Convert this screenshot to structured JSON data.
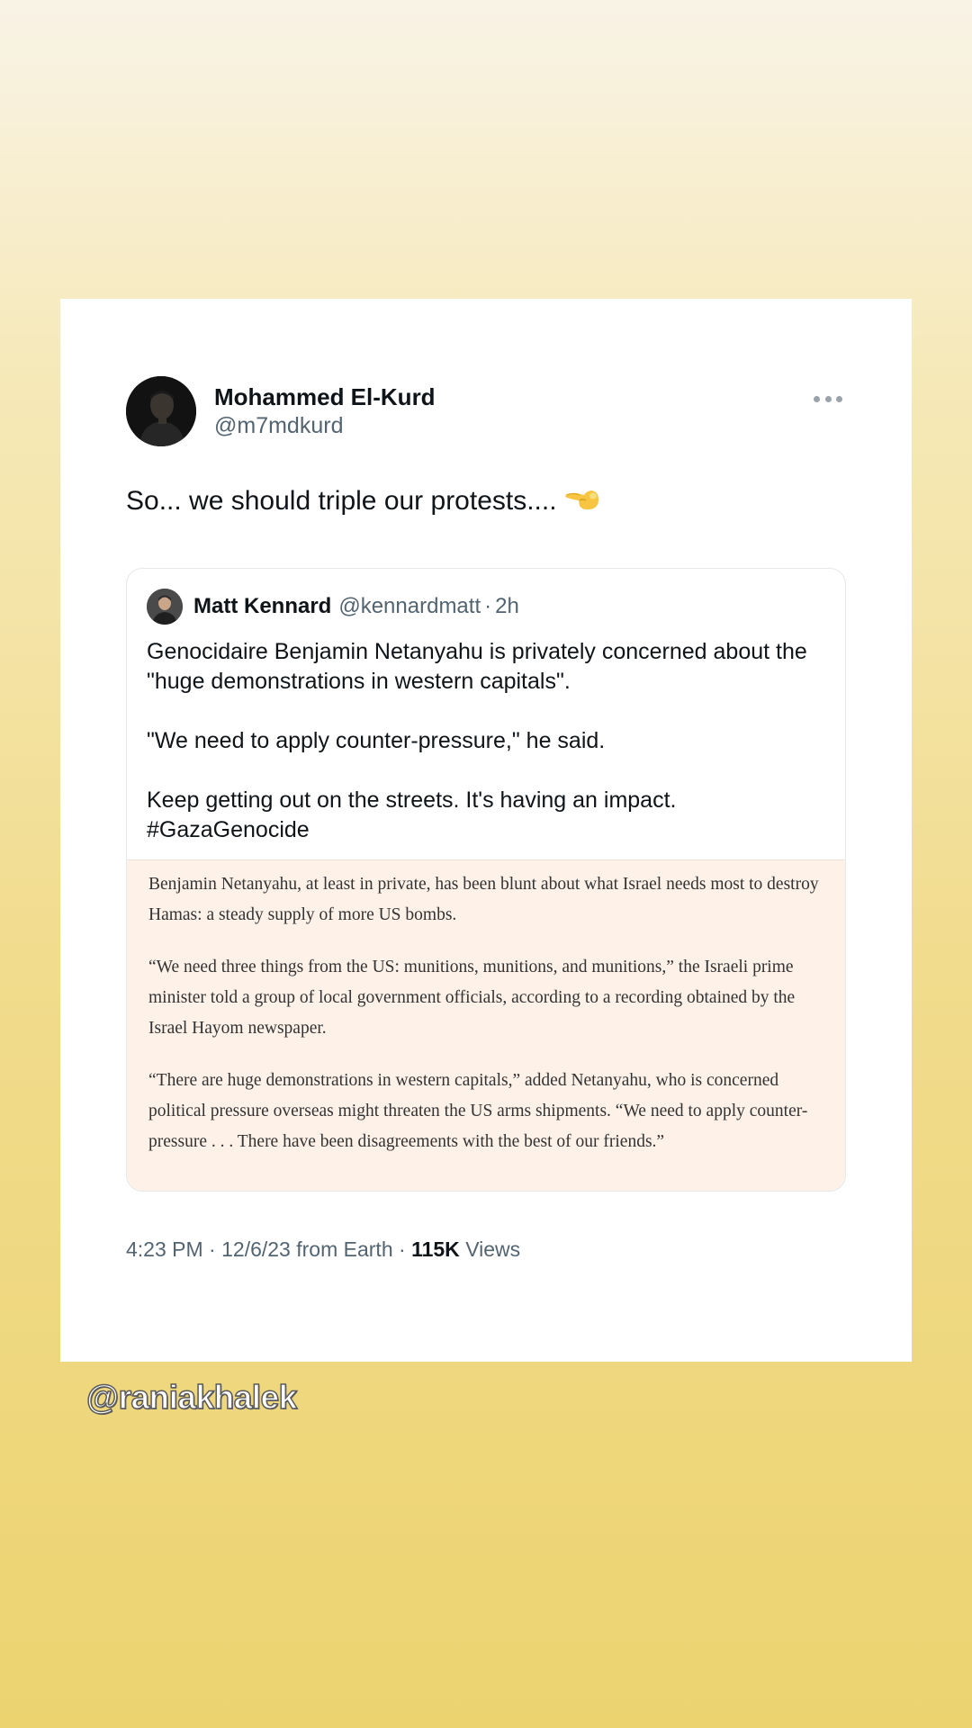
{
  "tweet": {
    "author_name": "Mohammed El-Kurd",
    "author_handle": "@m7mdkurd",
    "more_icon": "ellipsis-icon",
    "text": "So... we should triple our protests....",
    "emoji_icon": "pointing-hand-emoji-icon"
  },
  "quoted_tweet": {
    "author_name": "Matt Kennard",
    "author_handle": "@kennardmatt",
    "separator": "·",
    "time": "2h",
    "paragraphs": [
      "Genocidaire Benjamin Netanyahu is privately concerned about the \"huge demonstrations in western capitals\".",
      "\"We need to apply counter-pressure,\" he said.",
      "Keep getting out on the streets. It's having an impact.",
      "#GazaGenocide"
    ],
    "article_excerpt": [
      "Benjamin Netanyahu, at least in private, has been blunt about what Israel needs most to destroy Hamas: a steady supply of more US bombs.",
      "“We need three things from the US: munitions, munitions, and munitions,” the Israeli prime minister told a group of local government officials, according to a recording obtained by the Israel Hayom newspaper.",
      "“There are huge demonstrations in western capitals,” added Netanyahu, who is concerned political pressure overseas might threaten the US arms shipments. “We need to apply counter-pressure . . . There have been disagreements with the best of our friends.”"
    ]
  },
  "meta": {
    "time": "4:23 PM",
    "sep1": "·",
    "date": "12/6/23",
    "source": "from Earth",
    "sep2": "·",
    "views_count": "115K",
    "views_label": "Views"
  },
  "watermark": "@raniakhalek",
  "colors": {
    "background_top": "#f9f3e6",
    "background_bottom": "#ecd370",
    "card": "#ffffff",
    "article_bg": "#fdf1e8",
    "secondary_text": "#536471"
  }
}
